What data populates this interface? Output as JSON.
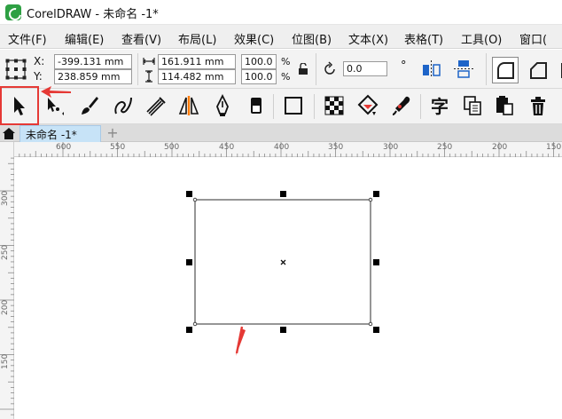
{
  "window": {
    "title": "CorelDRAW - 未命名 -1*"
  },
  "menu": {
    "items": [
      "文件(F)",
      "编辑(E)",
      "查看(V)",
      "布局(L)",
      "效果(C)",
      "位图(B)",
      "文本(X)",
      "表格(T)",
      "工具(O)",
      "窗口("
    ]
  },
  "propbar": {
    "x_label": "X:",
    "y_label": "Y:",
    "x_value": "-399.131 mm",
    "y_value": "238.859 mm",
    "width_value": "161.911 mm",
    "height_value": "114.482 mm",
    "scale_w": "100.0",
    "scale_h": "100.0",
    "pct": "%",
    "rotation": "0.0"
  },
  "tabs": {
    "document": "未命名 -1*",
    "add": "+"
  },
  "ruler": {
    "h_labels": [
      "600",
      "550",
      "500",
      "450",
      "400",
      "350",
      "300",
      "250",
      "200",
      "150"
    ],
    "v_labels": [
      "300",
      "250",
      "200",
      "150"
    ]
  },
  "colors": {
    "accent": "#e53935",
    "handle": "#000000"
  }
}
